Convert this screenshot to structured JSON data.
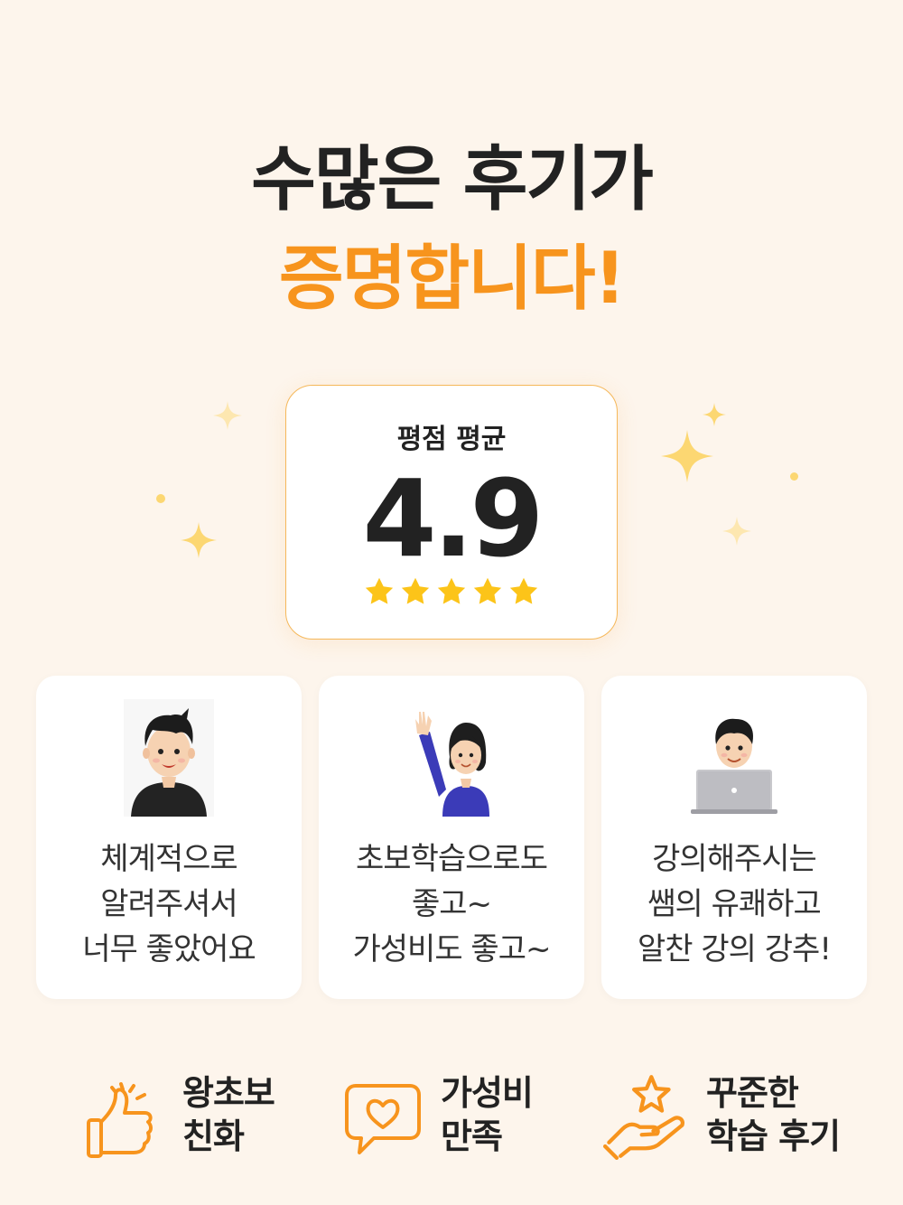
{
  "headline": {
    "line1": "수많은 후기가",
    "line2": "증명합니다!"
  },
  "rating": {
    "label": "평점 평균",
    "value": "4.9",
    "stars_filled": 5,
    "stars_total": 5
  },
  "reviews": [
    {
      "lines": [
        "체계적으로",
        "알려주셔서",
        "너무 좋았어요"
      ],
      "avatar": "man-black-shirt-avatar"
    },
    {
      "lines": [
        "초보학습으로도",
        "좋고~",
        "가성비도 좋고~"
      ],
      "avatar": "woman-waving-avatar"
    },
    {
      "lines": [
        "강의해주시는",
        "쌤의 유쾌하고",
        "알찬 강의 강추!"
      ],
      "avatar": "man-laptop-avatar"
    }
  ],
  "features": [
    {
      "lines": [
        "왕초보",
        "친화"
      ],
      "icon": "thumbs-up-icon"
    },
    {
      "lines": [
        "가성비",
        "만족"
      ],
      "icon": "heart-speech-bubble-icon"
    },
    {
      "lines": [
        "꾸준한",
        "학습 후기"
      ],
      "icon": "hand-star-icon"
    }
  ],
  "colors": {
    "background": "#fdf5ec",
    "accent": "#f7941d",
    "star": "#fcc419",
    "text": "#222222",
    "card_border": "#f5b85a"
  }
}
